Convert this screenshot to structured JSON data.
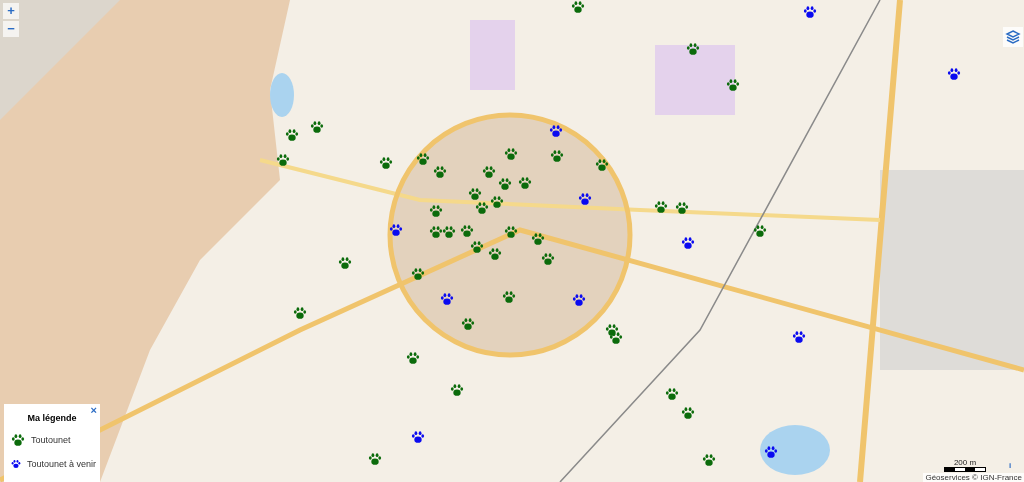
{
  "zoom_controls": [
    {
      "label": "+"
    },
    {
      "label": "−"
    }
  ],
  "markers": [
    {
      "color": "#0b6b0b"
    },
    {
      "color": "#0b6b0b"
    },
    {
      "color": "#0b6b0b"
    },
    {
      "color": "#0b6b0b"
    },
    {
      "color": "#0b6b0b"
    },
    {
      "color": "#0b6b0b"
    },
    {
      "color": "#0b6b0b"
    },
    {
      "color": "#0b6b0b"
    },
    {
      "color": "#0b6b0b"
    },
    {
      "color": "#0b6b0b"
    },
    {
      "color": "#0b6b0b"
    },
    {
      "color": "#0b6b0b"
    },
    {
      "color": "#0b6b0b"
    },
    {
      "color": "#0b6b0b"
    },
    {
      "color": "#0b6b0b"
    },
    {
      "color": "#0b6b0b"
    },
    {
      "color": "#0b6b0b"
    },
    {
      "color": "#0b6b0b"
    },
    {
      "color": "#0b6b0b"
    },
    {
      "color": "#0b6b0b"
    },
    {
      "color": "#0b6b0b"
    },
    {
      "color": "#0b6b0b"
    },
    {
      "color": "#0b6b0b"
    },
    {
      "color": "#0b6b0b"
    },
    {
      "color": "#0b6b0b"
    },
    {
      "color": "#0b6b0b"
    },
    {
      "color": "#0b6b0b"
    },
    {
      "color": "#0b6b0b"
    },
    {
      "color": "#0b6b0b"
    },
    {
      "color": "#0b6b0b"
    },
    {
      "color": "#0b6b0b"
    },
    {
      "color": "#0b6b0b"
    },
    {
      "color": "#0b6b0b"
    },
    {
      "color": "#0b6b0b"
    },
    {
      "color": "#0b6b0b"
    },
    {
      "color": "#0b6b0b"
    },
    {
      "color": "#0b6b0b"
    },
    {
      "color": "#0b6b0b"
    },
    {
      "color": "#0b6b0b"
    },
    {
      "color": "#0b6b0b"
    },
    {
      "color": "#0b6b0b"
    },
    {
      "color": "#0b6b0b"
    },
    {
      "color": "#0b6b0b"
    },
    {
      "color": "#0a0af0"
    },
    {
      "color": "#0a0af0"
    },
    {
      "color": "#0a0af0"
    },
    {
      "color": "#0a0af0"
    },
    {
      "color": "#0a0af0"
    },
    {
      "color": "#0a0af0"
    },
    {
      "color": "#0a0af0"
    },
    {
      "color": "#0a0af0"
    },
    {
      "color": "#0a0af0"
    },
    {
      "color": "#0a0af0"
    },
    {
      "color": "#0a0af0"
    }
  ],
  "legend": {
    "title": "Ma légende",
    "close": "×",
    "items": [
      {
        "label": "Toutounet",
        "color": "#0b6b0b"
      },
      {
        "label": "Toutounet à venir",
        "color": "#0a0af0"
      }
    ]
  },
  "scale": {
    "label": "200 m"
  },
  "info": "i",
  "attribution": "Géoservices © IGN-France"
}
